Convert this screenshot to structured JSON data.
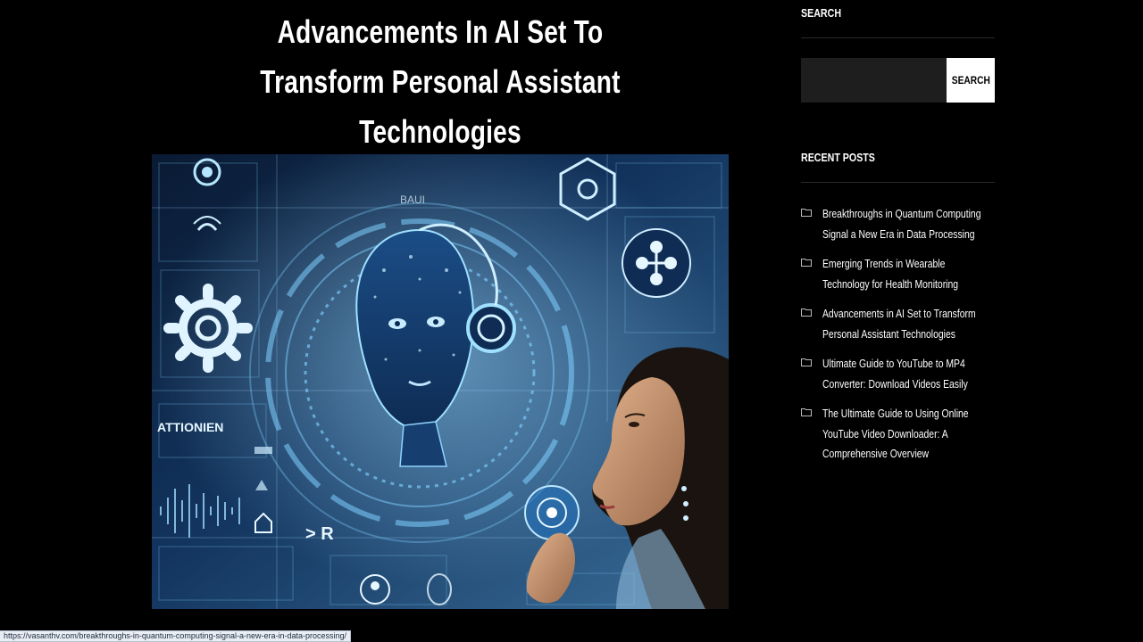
{
  "article": {
    "title": "Advancements In AI Set To Transform Personal Assistant Technologies",
    "image": {
      "panel_label": "ATTIONIEN",
      "top_label": "BAUI",
      "small_label": "> R"
    }
  },
  "sidebar": {
    "search": {
      "heading": "SEARCH",
      "input_value": "",
      "input_placeholder": "",
      "button_label": "SEARCH"
    },
    "recent_posts": {
      "heading": "RECENT POSTS",
      "items": [
        {
          "label": "Breakthroughs in Quantum Computing Signal a New Era in Data Processing"
        },
        {
          "label": "Emerging Trends in Wearable Technology for Health Monitoring"
        },
        {
          "label": "Advancements in AI Set to Transform Personal Assistant Technologies"
        },
        {
          "label": "Ultimate Guide to YouTube to MP4 Converter: Download Videos Easily"
        },
        {
          "label": "The Ultimate Guide to Using Online YouTube Video Downloader: A Comprehensive Overview"
        }
      ]
    }
  },
  "statusbar": {
    "url": "https://vasanthv.com/breakthroughs-in-quantum-computing-signal-a-new-era-in-data-processing/"
  },
  "colors": {
    "background": "#000000",
    "text": "#ffffff",
    "search_input_bg": "#1e1e1e",
    "button_bg": "#ffffff",
    "accent_glow": "#6ec8ff"
  }
}
